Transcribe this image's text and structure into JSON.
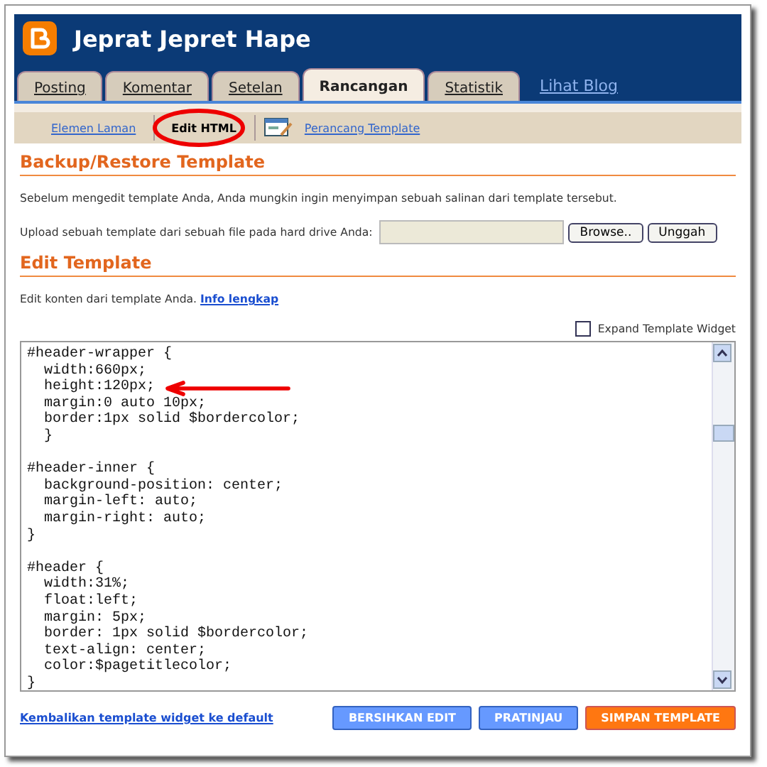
{
  "header": {
    "title": "Jeprat Jepret Hape"
  },
  "tabs": [
    {
      "label": "Posting",
      "selected": false
    },
    {
      "label": "Komentar",
      "selected": false
    },
    {
      "label": "Setelan",
      "selected": false
    },
    {
      "label": "Rancangan",
      "selected": true
    },
    {
      "label": "Statistik",
      "selected": false
    }
  ],
  "view_blog_link": "Lihat Blog",
  "subnav": [
    {
      "label": "Elemen Laman",
      "selected": false,
      "kind": "link"
    },
    {
      "label": "Edit HTML",
      "selected": true,
      "kind": "link"
    },
    {
      "label": "Perancang Template",
      "selected": false,
      "kind": "icon-link"
    }
  ],
  "backup": {
    "heading": "Backup/Restore Template",
    "note": "Sebelum mengedit template Anda, Anda mungkin ingin menyimpan sebuah salinan dari template tersebut.",
    "upload_label": "Upload sebuah template dari sebuah file pada hard drive Anda:",
    "browse_button": "Browse..",
    "upload_button": "Unggah"
  },
  "edit": {
    "heading": "Edit Template",
    "note": "Edit konten dari template Anda.",
    "info_link": "Info lengkap",
    "expand_label": "Expand Template Widget",
    "expand_checked": false,
    "code_blocks": [
      [
        "#header-wrapper {",
        "  width:660px;",
        "  height:120px;",
        "  margin:0 auto 10px;",
        "  border:1px solid $bordercolor;",
        "  }"
      ],
      [
        "#header-inner {",
        "  background-position: center;",
        "  margin-left: auto;",
        "  margin-right: auto;",
        "}"
      ],
      [
        "#header {",
        "  width:31%;",
        "  float:left;",
        "  margin: 5px;",
        "  border: 1px solid $bordercolor;",
        "  text-align: center;",
        "  color:$pagetitlecolor;",
        "}"
      ]
    ]
  },
  "footer": {
    "reset_link": "Kembalikan template widget ke default",
    "buttons": [
      {
        "label": "BERSIHKAN EDIT",
        "kind": "secondary"
      },
      {
        "label": "PRATINJAU",
        "kind": "secondary"
      },
      {
        "label": "SIMPAN TEMPLATE",
        "kind": "primary"
      }
    ]
  }
}
